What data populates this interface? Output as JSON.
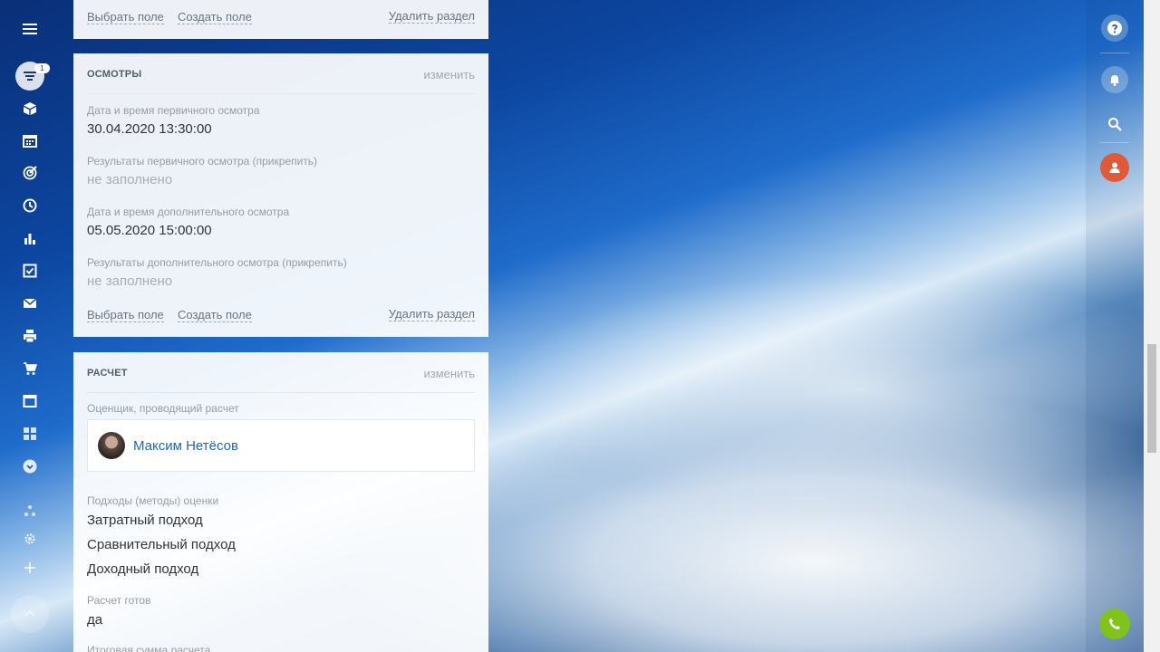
{
  "nav": {
    "filter_badge": "1",
    "icons": [
      "menu-icon",
      "filter-icon",
      "box-icon",
      "calendar-icon",
      "target-icon",
      "clock-icon",
      "chart-icon",
      "task-icon",
      "mail-icon",
      "printer-icon",
      "cart-icon",
      "window-icon",
      "apps-icon",
      "chevron-down-icon",
      "sitemap-icon",
      "gear-icon",
      "plus-icon",
      "arrow-up-icon"
    ]
  },
  "top_section": {
    "select_field": "Выбрать поле",
    "create_field": "Создать поле",
    "delete_section": "Удалить раздел"
  },
  "osmotry": {
    "title": "ОСМОТРЫ",
    "edit": "изменить",
    "fields": [
      {
        "label": "Дата и время первичного осмотра",
        "value": "30.04.2020 13:30:00"
      },
      {
        "label": "Результаты первичного осмотра (прикрепить)",
        "value": "не заполнено"
      },
      {
        "label": "Дата и время дополнительного осмотра",
        "value": "05.05.2020 15:00:00"
      },
      {
        "label": "Результаты дополнительного осмотра (прикрепить)",
        "value": "не заполнено"
      }
    ],
    "select_field": "Выбрать поле",
    "create_field": "Создать поле",
    "delete_section": "Удалить раздел"
  },
  "raschet": {
    "title": "РАСЧЕТ",
    "edit": "изменить",
    "appraiser_label": "Оценщик, проводящий расчет",
    "appraiser_name": "Максим Нетёсов",
    "methods_label": "Подходы (методы) оценки",
    "methods": [
      "Затратный подход",
      "Сравнительный подход",
      "Доходный подход"
    ],
    "ready_label": "Расчет готов",
    "ready_value": "да",
    "total_label": "Итоговая сумма расчета"
  },
  "colors": {
    "accent_link": "#2067b0",
    "user_button": "#e05a3a",
    "call_button": "#7fc31b"
  }
}
